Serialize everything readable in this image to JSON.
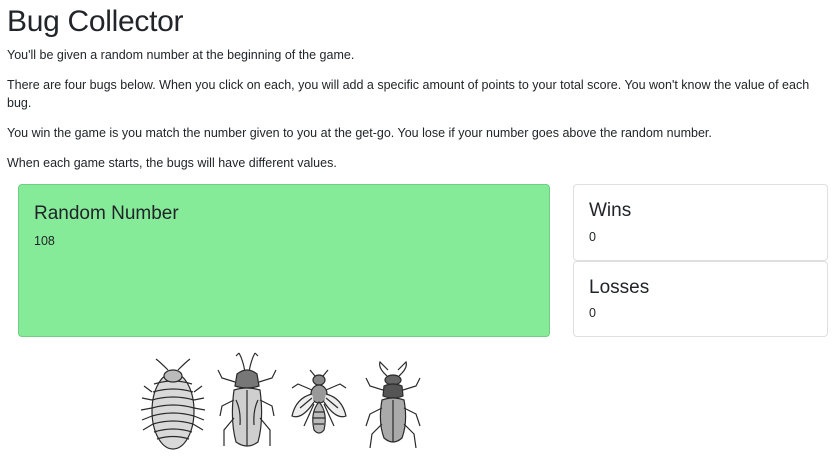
{
  "page": {
    "title": "Bug Collector",
    "paragraphs": [
      "You'll be given a random number at the beginning of the game.",
      "There are four bugs below. When you click on each, you will add a specific amount of points to your total score. You won't know the value of each bug.",
      "You win the game is you match the number given to you at the get-go. You lose if your number goes above the random number.",
      "When each game starts, the bugs will have different values."
    ]
  },
  "random_card": {
    "title": "Random Number",
    "value": "108",
    "color": "#86eb98"
  },
  "wins_card": {
    "title": "Wins",
    "value": "0"
  },
  "losses_card": {
    "title": "Losses",
    "value": "0"
  },
  "bugs": [
    {
      "name": "pill-bug-icon"
    },
    {
      "name": "rhinoceros-beetle-icon"
    },
    {
      "name": "fly-icon"
    },
    {
      "name": "stag-beetle-icon"
    }
  ]
}
